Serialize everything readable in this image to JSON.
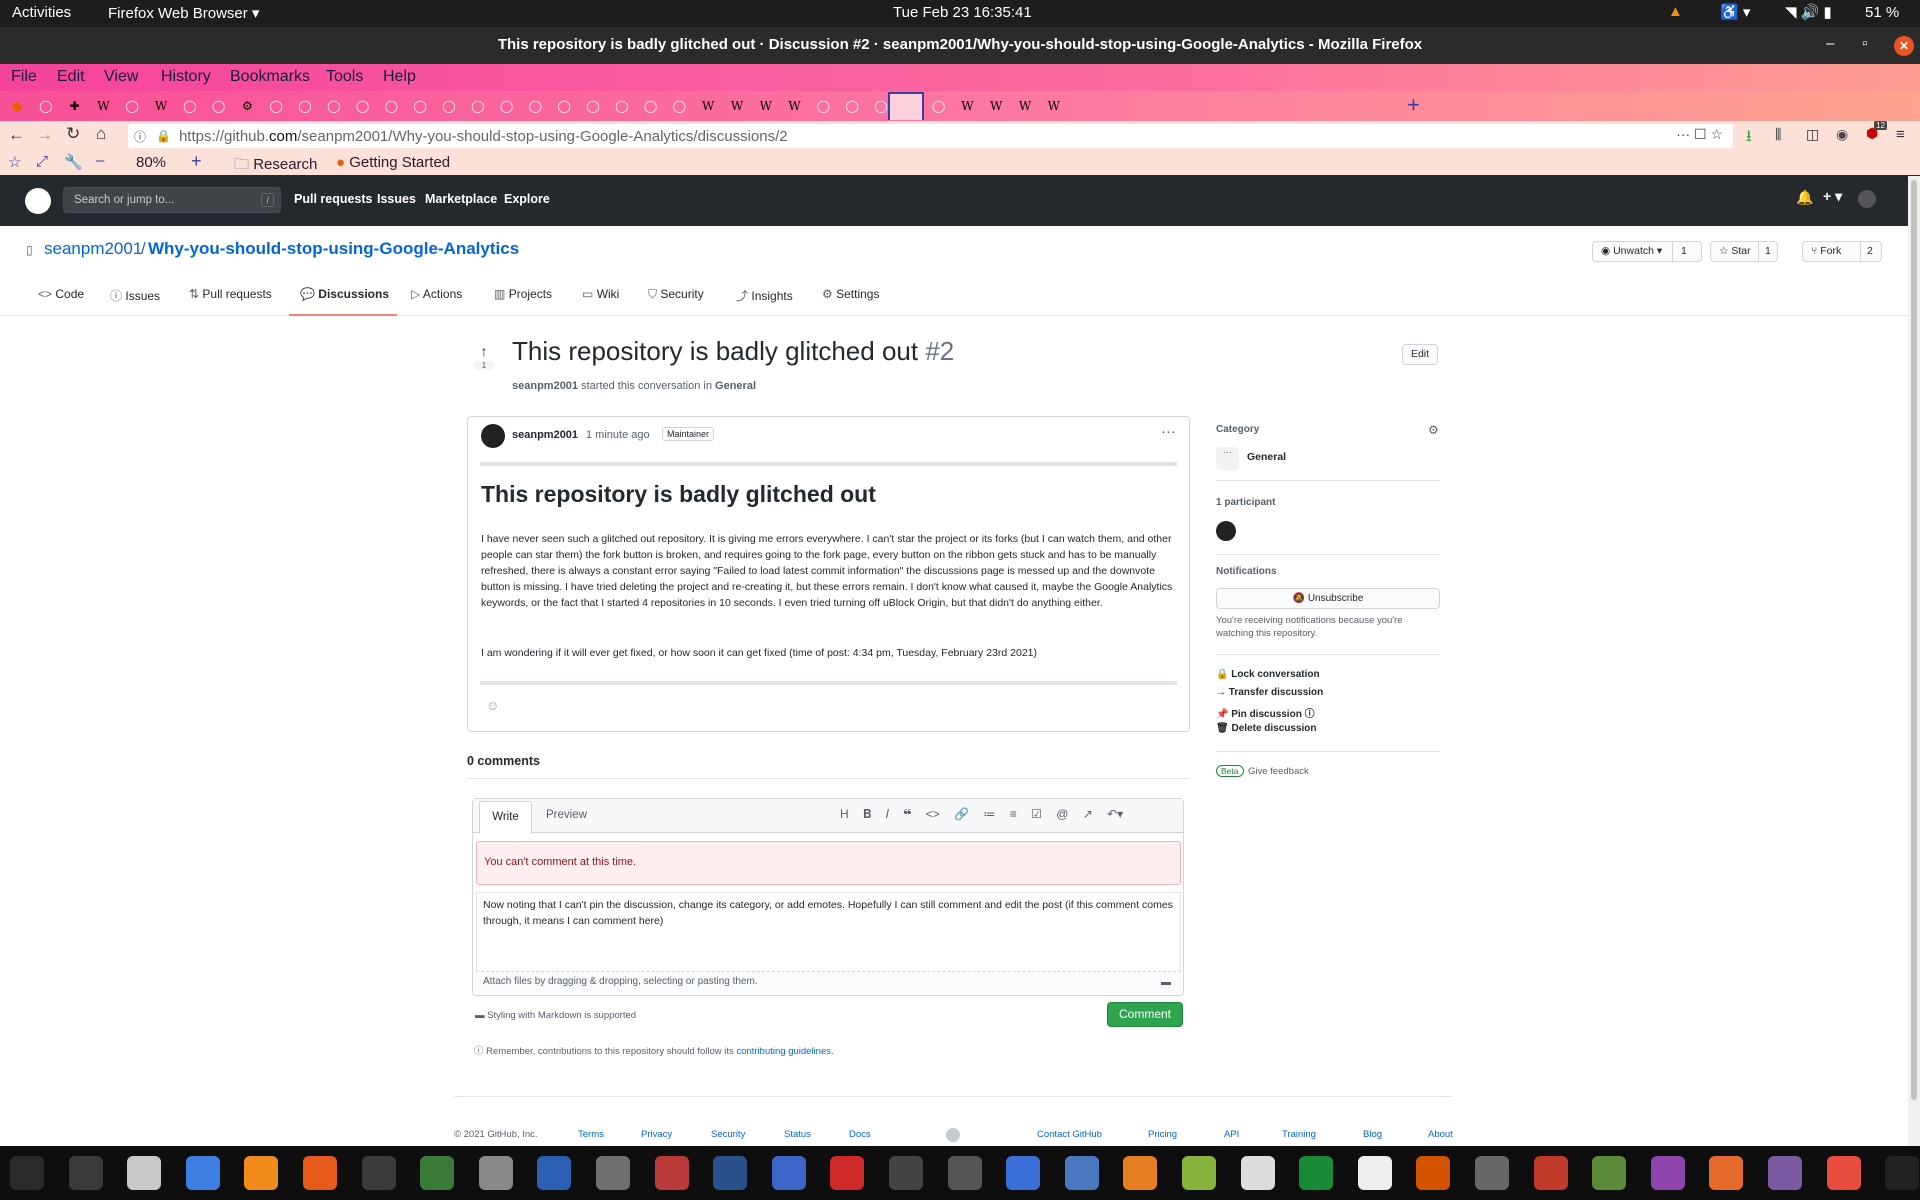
{
  "system": {
    "activities": "Activities",
    "app_menu": "Firefox Web Browser",
    "clock": "Tue Feb 23  16:35:41",
    "battery": "51 %"
  },
  "window": {
    "title": "This repository is badly glitched out · Discussion #2 · seanpm2001/Why-you-should-stop-using-Google-Analytics - Mozilla Firefox"
  },
  "menu": [
    "File",
    "Edit",
    "View",
    "History",
    "Bookmarks",
    "Tools",
    "Help"
  ],
  "browser": {
    "url_prefix": "https://github.",
    "url_domain": "com",
    "url_rest": "/seanpm2001/Why-you-should-stop-using-Google-Analytics/discussions/2",
    "zoom": "80%",
    "bookmarks": [
      "Research",
      "Getting Started"
    ],
    "badge_count": "12"
  },
  "github": {
    "search_placeholder": "Search or jump to...",
    "search_key": "/",
    "nav": [
      "Pull requests",
      "Issues",
      "Marketplace",
      "Explore"
    ],
    "owner": "seanpm2001",
    "sep": "/",
    "repo": "Why-you-should-stop-using-Google-Analytics",
    "watch_label": "Unwatch",
    "watch_count": "1",
    "star_label": "Star",
    "star_count": "1",
    "fork_label": "Fork",
    "fork_count": "2",
    "tabs": [
      "Code",
      "Issues",
      "Pull requests",
      "Discussions",
      "Actions",
      "Projects",
      "Wiki",
      "Security",
      "Insights",
      "Settings"
    ]
  },
  "discussion": {
    "vote_count": "1",
    "title": "This repository is badly glitched out",
    "number": "#2",
    "edit_label": "Edit",
    "author": "seanpm2001",
    "started_text": "started this conversation in",
    "category": "General",
    "time_ago": "1 minute ago",
    "role_badge": "Maintainer",
    "post_heading": "This repository is badly glitched out",
    "para1": "I have never seen such a glitched out repository. It is giving me errors everywhere. I can't star the project or its forks (but I can watch them, and other people can star them) the fork button is broken, and requires going to the fork page, every button on the ribbon gets stuck and has to be manually refreshed, there is always a constant error saying \"Failed to load latest commit information\" the discussions page is messed up and the downvote button is missing. I have tried deleting the project and re-creating it, but these errors remain. I don't know what caused it, maybe the Google Analytics keywords, or the fact that I started 4 repositories in 10 seconds. I even tried turning off uBlock Origin, but that didn't do anything either.",
    "para2": "I am wondering if it will ever get fixed, or how soon it can get fixed (time of post: 4:34 pm, Tuesday, February 23rd 2021)",
    "comments_count": "0 comments",
    "write_tab": "Write",
    "preview_tab": "Preview",
    "error_msg": "You can't comment at this time.",
    "comment_text": "Now noting that I can't pin the discussion, change its category, or add emotes. Hopefully I can still comment and edit the post (if this comment comes through, it means I can comment here)",
    "attach_text": "Attach files by dragging & dropping, selecting or pasting them.",
    "markdown_note": "Styling with Markdown is supported",
    "comment_button": "Comment",
    "remember_text": "Remember, contributions to this repository should follow its",
    "guidelines_link": "contributing guidelines."
  },
  "sidebar": {
    "category_label": "Category",
    "category_value": "General",
    "participants_label": "1 participant",
    "notifications_label": "Notifications",
    "unsubscribe": "Unsubscribe",
    "notif_note": "You're receiving notifications because you're watching this repository.",
    "actions": [
      "Lock conversation",
      "Transfer discussion",
      "Pin discussion",
      "Delete discussion"
    ],
    "beta": "Beta",
    "feedback": "Give feedback"
  },
  "footer": {
    "copyright": "© 2021 GitHub, Inc.",
    "left_links": [
      "Terms",
      "Privacy",
      "Security",
      "Status",
      "Docs"
    ],
    "right_links": [
      "Contact GitHub",
      "Pricing",
      "API",
      "Training",
      "Blog",
      "About"
    ]
  }
}
